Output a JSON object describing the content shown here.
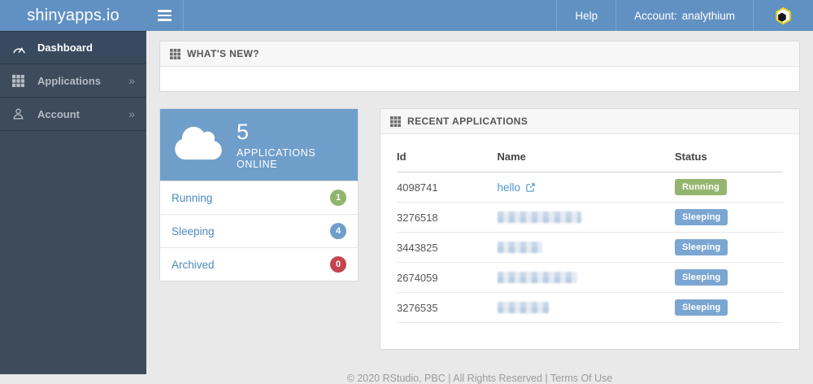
{
  "navbar": {
    "brand": "shinyapps.io",
    "help": "Help",
    "account_label": "Account:",
    "account_value": "analythium",
    "bg_color": "#6191c2"
  },
  "sidebar": {
    "bg_color": "#3e4b5a",
    "items": [
      {
        "label": "Dashboard",
        "active": true,
        "arrow": ""
      },
      {
        "label": "Applications",
        "active": false,
        "arrow": "»"
      },
      {
        "label": "Account",
        "active": false,
        "arrow": "»"
      }
    ]
  },
  "panels": {
    "whats_new_title": "WHAT'S NEW?",
    "recent_title": "RECENT APPLICATIONS"
  },
  "summary": {
    "box_color": "#6f9ecb",
    "count": "5",
    "caption": "APPLICATIONS ONLINE",
    "rows": [
      {
        "label": "Running",
        "count": "1",
        "badge_color": "#8fb56f"
      },
      {
        "label": "Sleeping",
        "count": "4",
        "badge_color": "#6f9ecb"
      },
      {
        "label": "Archived",
        "count": "0",
        "badge_color": "#c4454f"
      }
    ]
  },
  "recent": {
    "columns": {
      "id": "Id",
      "name": "Name",
      "status": "Status"
    },
    "rows": [
      {
        "id": "4098741",
        "name": "hello",
        "status": "Running",
        "status_color": "#95b56f"
      },
      {
        "id": "3276518",
        "status": "Sleeping",
        "status_color": "#7ba6d1",
        "redacted_width": 103
      },
      {
        "id": "3443825",
        "status": "Sleeping",
        "status_color": "#7ba6d1",
        "redacted_width": 55
      },
      {
        "id": "2674059",
        "status": "Sleeping",
        "status_color": "#7ba6d1",
        "redacted_width": 98
      },
      {
        "id": "3276535",
        "status": "Sleeping",
        "status_color": "#7ba6d1",
        "redacted_width": 63
      }
    ]
  },
  "footer": {
    "text": "© 2020 RStudio, PBC | All Rights Reserved | Terms Of Use"
  }
}
